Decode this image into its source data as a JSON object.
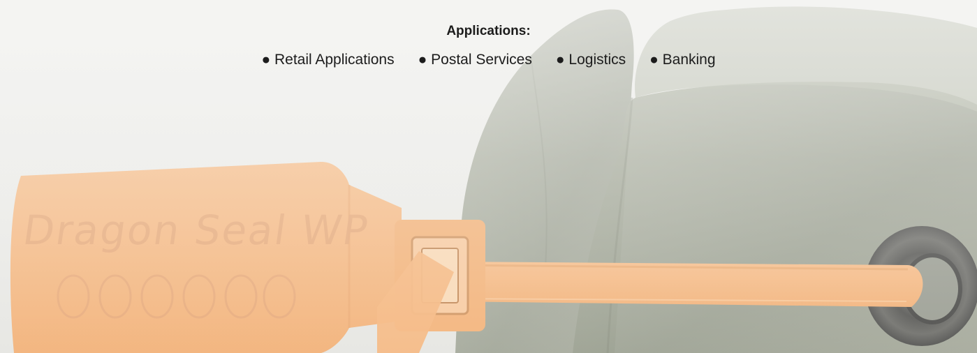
{
  "header": {
    "title": "Applications:"
  },
  "applications": [
    {
      "bullet": "●",
      "label": "Retail Applications"
    },
    {
      "bullet": "●",
      "label": "Postal Services"
    },
    {
      "bullet": "●",
      "label": "Logistics"
    },
    {
      "bullet": "●",
      "label": "Banking"
    }
  ],
  "product_photo": {
    "tag_text": "Dragon Seal WP",
    "tag_color": "#f6a766",
    "bag_color": "#7e8672",
    "grommet_color": "#3a3a38"
  }
}
